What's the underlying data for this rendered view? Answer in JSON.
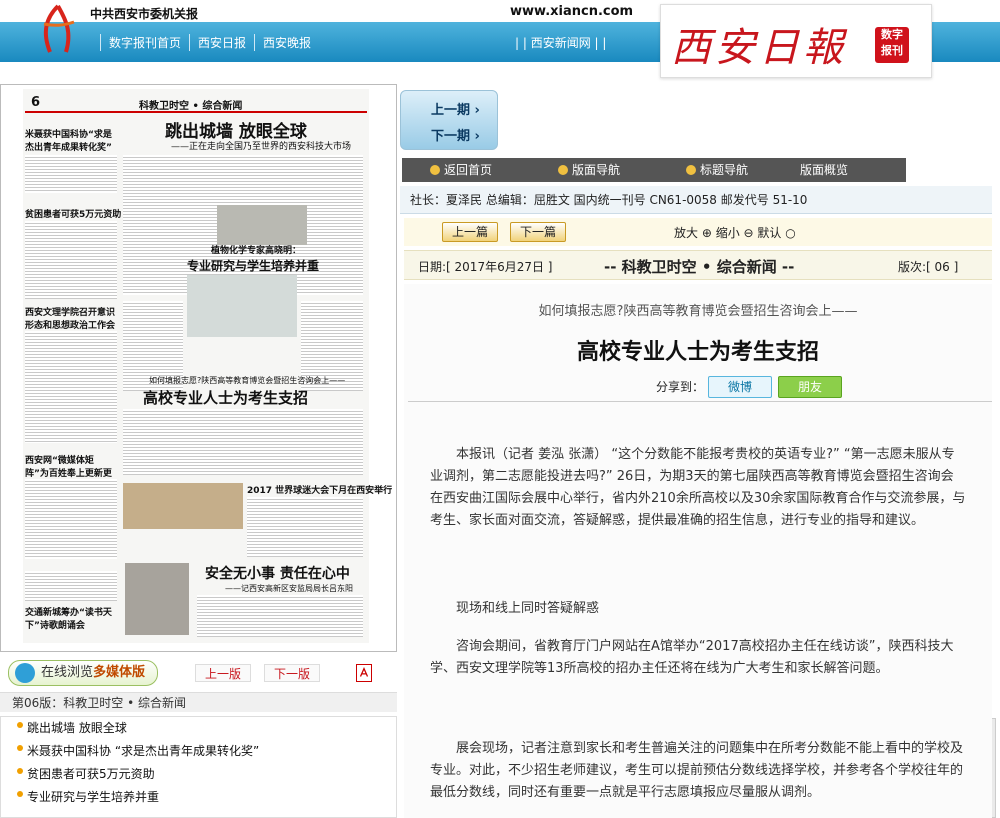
{
  "header": {
    "org_name": "中共西安市委机关报",
    "site_url": "www.xiancn.com",
    "nav": [
      "数字报刊首页",
      "西安日报",
      "西安晚报"
    ],
    "nav_right": "| |  西安新闻网  | |",
    "brand_title": "西安日報",
    "brand_tag_line1": "数字",
    "brand_tag_line2": "报刊"
  },
  "newspaper_thumb": {
    "page_num": "6",
    "section_banner": "科教卫时空 • 综合新闻",
    "h1": "跳出城墙 放眼全球",
    "h1_sub": "——正在走向全国乃至世界的西安科技大市场",
    "h2": "米聂获中国科协“求是杰出青年成果转化奖”",
    "h3": "贫困患者可获5万元资助",
    "h4": "植物化学专家高晓明：",
    "h4b": "专业研究与学生培养并重",
    "h5": "如何填报志愿?陕西高等教育博览会暨招生咨询会上——",
    "h5b": "高校专业人士为考生支招",
    "h6": "2017 世界球迷大会下月在西安举行",
    "h7": "安全无小事 责任在心中",
    "h7_sub": "——记西安高新区安监局局长吕东阳",
    "h8": "西安网“微媒体矩阵”为百姓奉上更新更快资讯",
    "h9": "交通新城筹办“读书天下”诗歌朗诵会",
    "h10": "西安文理学院召开意识形态和思想政治工作会"
  },
  "paper_controls": {
    "online_label_1": "在线浏览",
    "online_label_2": "多媒体版",
    "prev_page": "上一版",
    "next_page": "下一版"
  },
  "section_header": "第06版：科教卫时空 • 综合新闻",
  "article_list": [
    "跳出城墙 放眼全球",
    "米聂获中国科协 “求是杰出青年成果转化奖”",
    "贫困患者可获5万元资助",
    "专业研究与学生培养并重"
  ],
  "right": {
    "prev_issue": "上一期 ›",
    "next_issue": "下一期 ›",
    "nav_home": "返回首页",
    "nav_layout": "版面导航",
    "nav_title": "标题导航",
    "nav_overview": "版面概览",
    "info": "社长：夏泽民   总编辑：屈胜文      国内统一刊号  CN61-0058   邮发代号  51-10",
    "prev_article": "上一篇",
    "next_article": "下一篇",
    "zoom_in": "放大",
    "zoom_out": "缩小",
    "zoom_default": "默认",
    "date": "日期:[ 2017年6月27日 ]",
    "section_title": "-- 科教卫时空 • 综合新闻 --",
    "page_no": "版次:[ 06 ]",
    "subtitle": "如何填报志愿?陕西高等教育博览会暨招生咨询会上——",
    "headline": "高校专业人士为考生支招",
    "share_label": "分享到：",
    "share_weibo": "微博",
    "share_pengyou": "朋友",
    "paragraphs": [
      "本报讯（记者 姜泓 张潇）  “这个分数能不能报考贵校的英语专业?”  “第一志愿未服从专业调剂，第二志愿能投进去吗?”  26日，为期3天的第七届陕西高等教育博览会暨招生咨询会在西安曲江国际会展中心举行，省内外210余所高校以及30余家国际教育合作与交流参展，与考生、家长面对面交流，答疑解惑，提供最准确的招生信息，进行专业的指导和建议。",
      "现场和线上同时答疑解惑",
      "咨询会期间，省教育厅门户网站在A馆举办“2017高校招办主任在线访谈”，陕西科技大学、西安文理学院等13所高校的招办主任还将在线为广大考生和家长解答问题。",
      "展会现场，记者注意到家长和考生普遍关注的问题集中在所考分数能不能上看中的学校及专业。对此，不少招生老师建议，考生可以提前预估分数线选择学校，并参考各个学校往年的最低分数线，同时还有重要一点就是平行志愿填报应尽量服从调剂。"
    ]
  }
}
